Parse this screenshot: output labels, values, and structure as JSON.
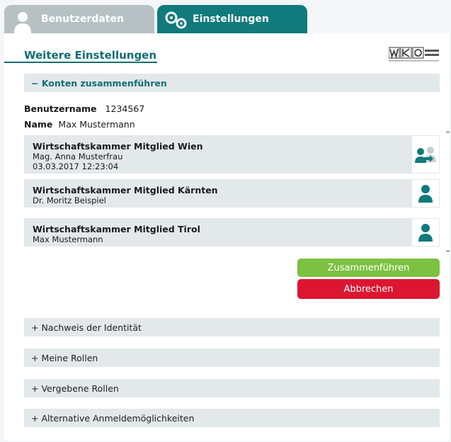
{
  "tabs": {
    "user": {
      "label": "Benutzerdaten"
    },
    "settings": {
      "label": "Einstellungen"
    }
  },
  "section": {
    "title": "Weitere Einstellungen"
  },
  "logo": {
    "text": "WKO",
    "icon": "wko-logo"
  },
  "accordion_open": {
    "label": "− Konten zusammenführen"
  },
  "account": {
    "username_label": "Benutzername",
    "username_value": "1234567",
    "name_label": "Name",
    "name_value": "Max Mustermann"
  },
  "cards": [
    {
      "title": "Wirtschaftskammer Mitglied Wien",
      "line1": "Mag. Anna Musterfrau",
      "line2": "03.03.2017 12:23:04",
      "icon": "user-transfer-icon"
    },
    {
      "title": "Wirtschaftskammer Mitglied Kärnten",
      "line1": "Dr. Moritz Beispiel",
      "icon": "user-icon"
    },
    {
      "title": "Wirtschaftskammer Mitglied Tirol",
      "line1": "Max Mustermann",
      "icon": "user-icon"
    }
  ],
  "buttons": {
    "merge": "Zusammenführen",
    "cancel": "Abbrechen"
  },
  "accordion_closed": [
    {
      "label": "+ Nachweis der Identität"
    },
    {
      "label": "+ Meine Rollen"
    },
    {
      "label": "+ Vergebene Rollen"
    },
    {
      "label": "+ Alternative Anmeldemöglichkeiten"
    }
  ],
  "colors": {
    "teal": "#117a7c",
    "green": "#7cc141",
    "red": "#dc1630",
    "bar": "#e3e8ea"
  }
}
